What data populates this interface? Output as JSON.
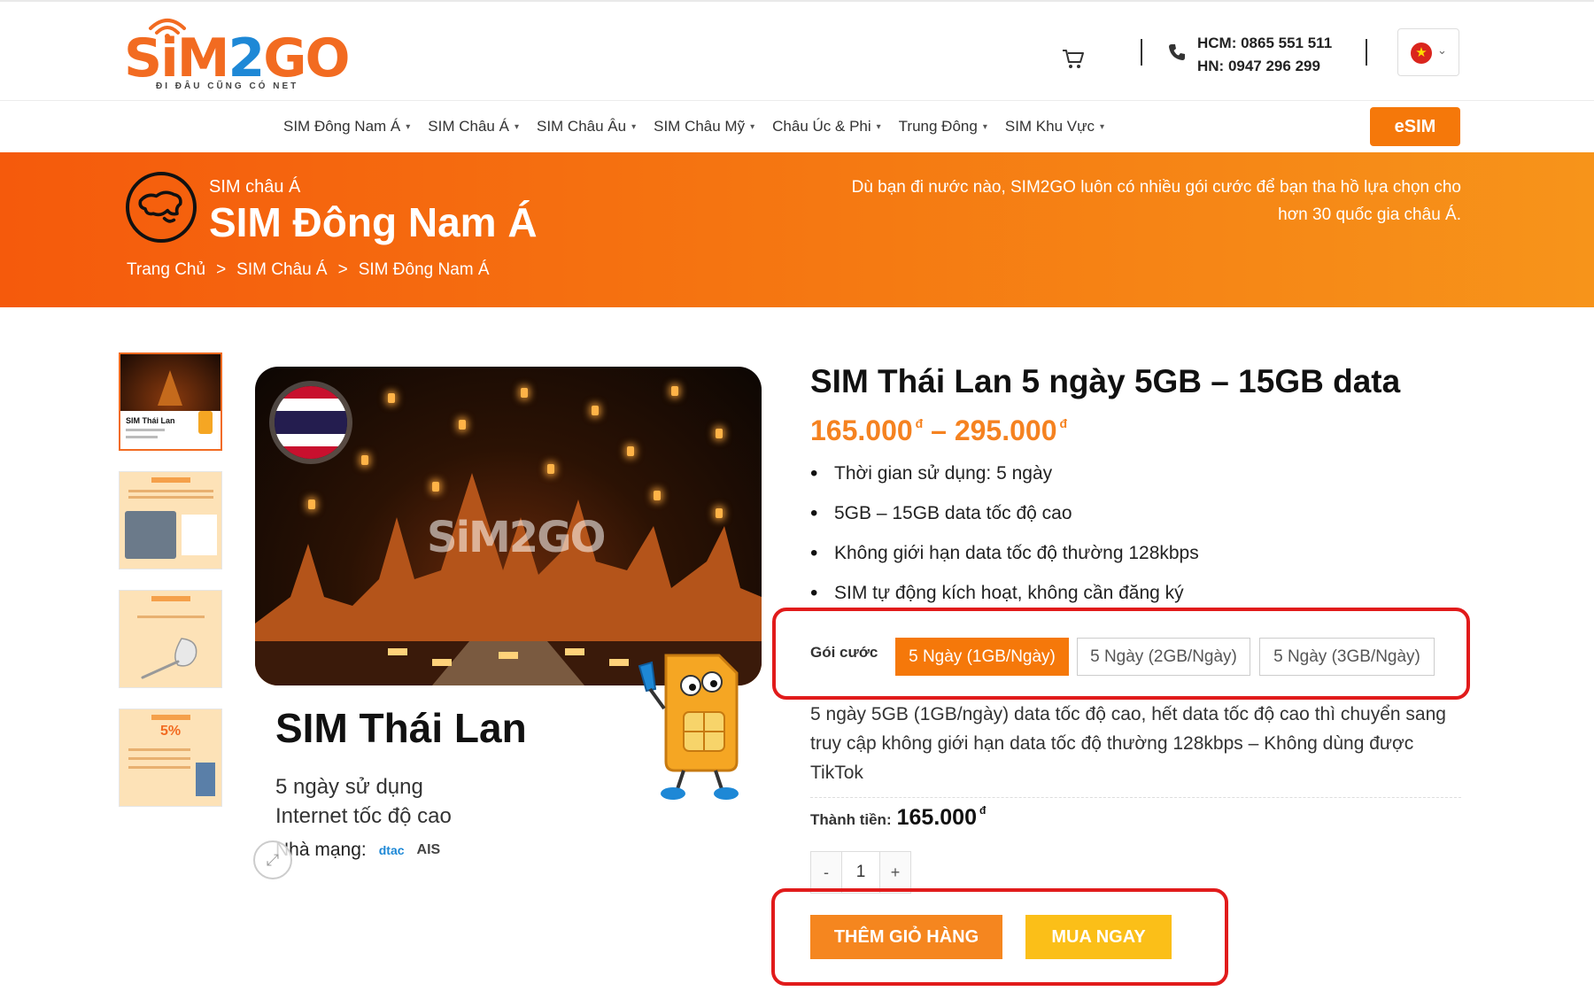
{
  "header": {
    "logo_text_a": "SiM",
    "logo_text_b": "2",
    "logo_text_c": "GO",
    "logo_tagline": "ĐI ĐÂU CŨNG CÓ NET",
    "phone_hcm": "HCM: 0865 551 511",
    "phone_hn": "HN: 0947 296 299",
    "language_flag_icon": "vietnam-flag-icon"
  },
  "nav": {
    "items": [
      {
        "label": "SIM Đông Nam Á"
      },
      {
        "label": "SIM Châu Á"
      },
      {
        "label": "SIM Châu Âu"
      },
      {
        "label": "SIM Châu Mỹ"
      },
      {
        "label": "Châu Úc & Phi"
      },
      {
        "label": "Trung Đông"
      },
      {
        "label": "SIM Khu Vực"
      }
    ],
    "esim_label": "eSIM"
  },
  "banner": {
    "subtitle": "SIM châu Á",
    "title": "SIM Đông Nam Á",
    "breadcrumb": [
      "Trang Chủ",
      "SIM Châu Á",
      "SIM Đông Nam Á"
    ],
    "breadcrumb_sep": ">",
    "description_line1": "Dù bạn đi nước nào, SIM2GO luôn có nhiều gói cước để bạn tha hồ lựa chọn cho",
    "description_line2": "hơn 30 quốc gia châu Á."
  },
  "gallery": {
    "thumb1_label": "SIM Thái Lan",
    "thumb4_badge": "5%",
    "main_title": "SIM Thái Lan",
    "main_sub1": "5 ngày sử dụng",
    "main_sub2": "Internet tốc độ cao",
    "network_label": "Nhà mạng:",
    "network1": "dtac",
    "network2": "AIS",
    "watermark": "SiM2GO"
  },
  "product": {
    "title": "SIM Thái Lan 5 ngày 5GB – 15GB data",
    "price_low": "165.000",
    "price_sep": "–",
    "price_high": "295.000",
    "currency": "đ",
    "features": [
      "Thời gian sử dụng: 5 ngày",
      "5GB – 15GB data tốc độ cao",
      "Không giới hạn data tốc độ thường 128kbps",
      "SIM tự động kích hoạt, không cần đăng ký"
    ],
    "package_label": "Gói cước",
    "options": [
      {
        "label": "5 Ngày (1GB/Ngày)",
        "selected": true
      },
      {
        "label": "5 Ngày (2GB/Ngày)",
        "selected": false
      },
      {
        "label": "5 Ngày (3GB/Ngày)",
        "selected": false
      }
    ],
    "description": "5 ngày 5GB (1GB/ngày) data tốc độ cao, hết data tốc độ cao thì chuyển sang truy cập không giới hạn data tốc độ thường 128kbps – Không dùng được TikTok",
    "total_label": "Thành tiền:",
    "total_value": "165.000",
    "qty_minus": "-",
    "qty_value": "1",
    "qty_plus": "+",
    "add_to_cart": "THÊM GIỎ HÀNG",
    "buy_now": "MUA NGAY"
  },
  "colors": {
    "brand_orange": "#f5780a",
    "price_orange": "#f58220",
    "buy_yellow": "#fbbf18",
    "highlight_red": "#e11b1b"
  }
}
